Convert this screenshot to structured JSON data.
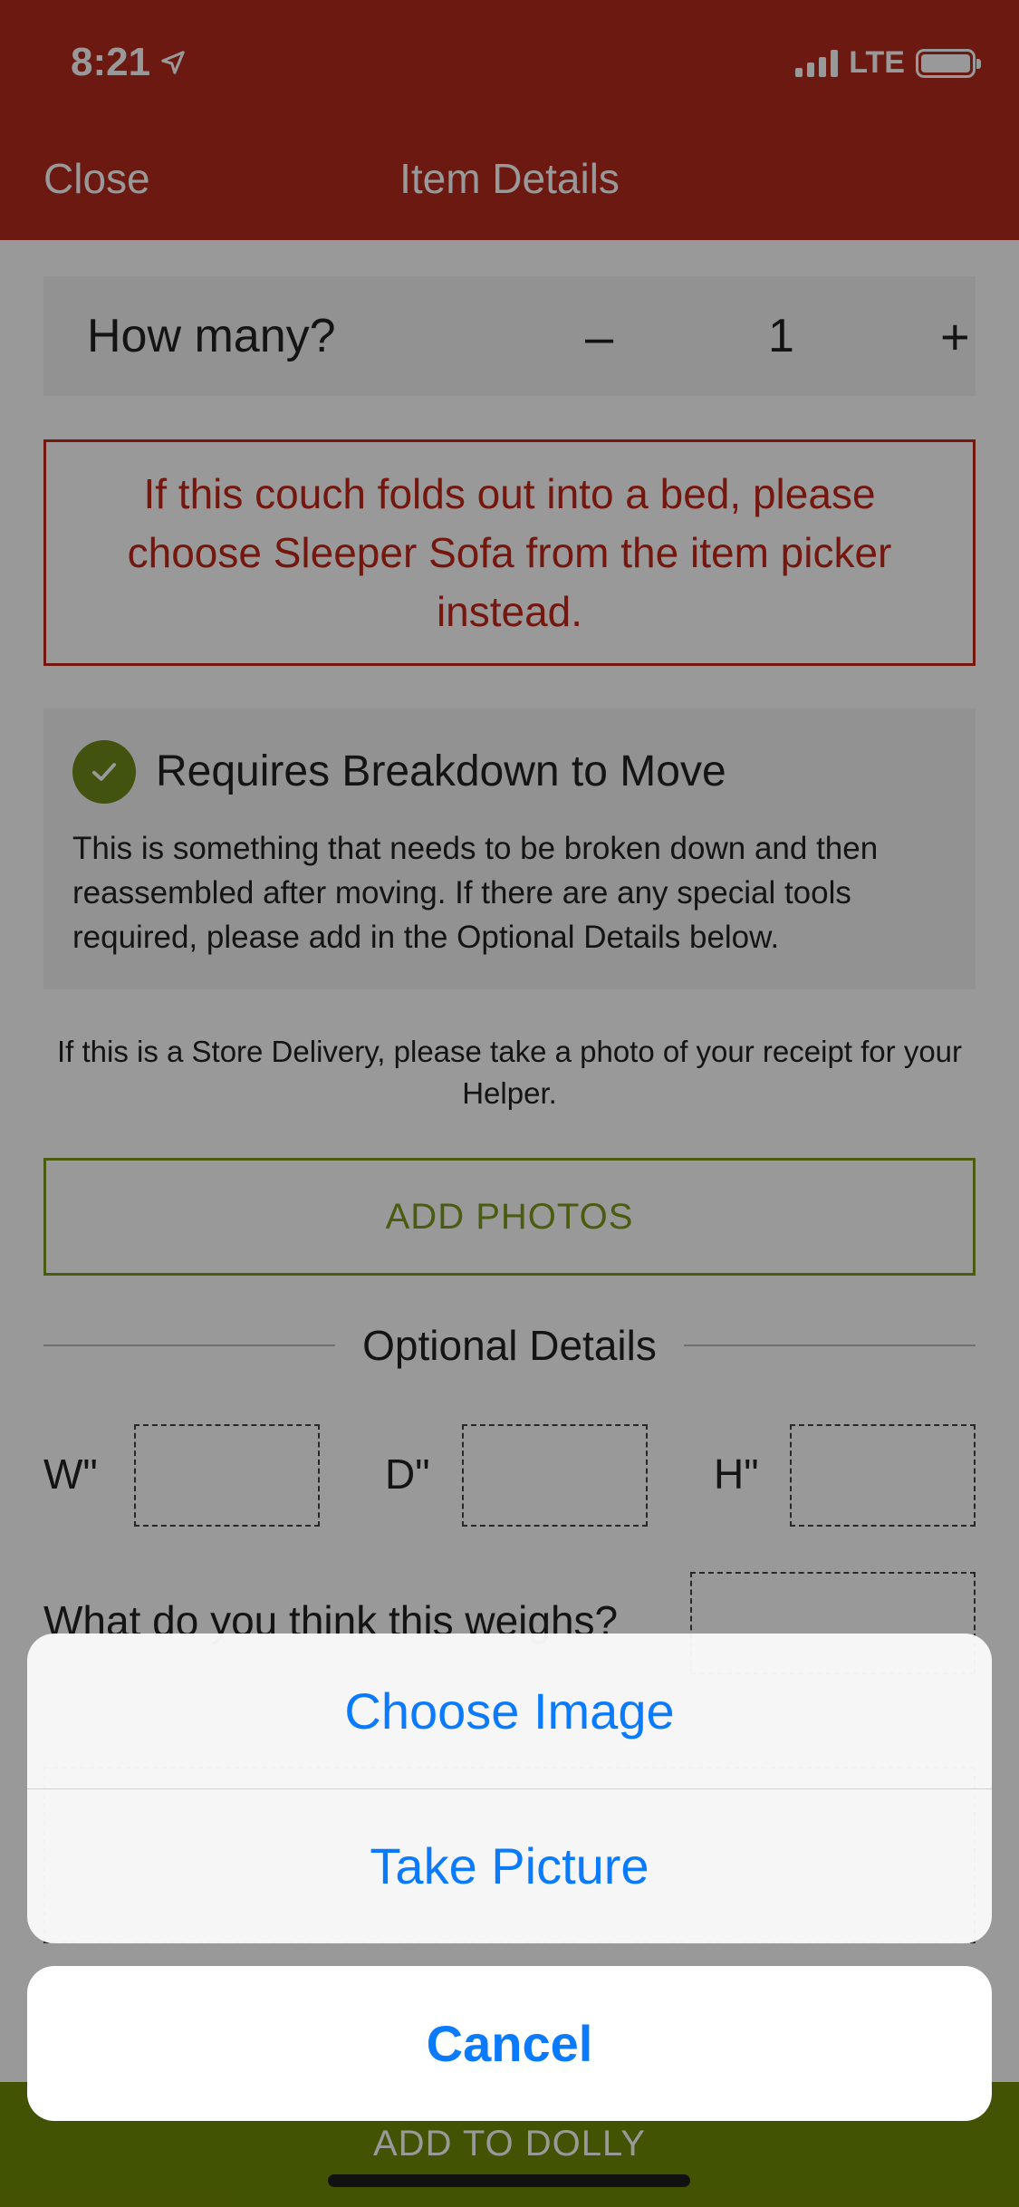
{
  "status_bar": {
    "time": "8:21",
    "network": "LTE",
    "location_icon": "location-arrow-icon",
    "signal_icon": "signal-bars-icon",
    "battery_icon": "battery-icon"
  },
  "header": {
    "close_label": "Close",
    "title": "Item Details",
    "background_color": "#b42b1d"
  },
  "quantity": {
    "label": "How many?",
    "minus_label": "–",
    "value": "1",
    "plus_label": "+"
  },
  "warning": {
    "text": "If this couch folds out into a bed, please choose Sleeper Sofa from the item picker instead.",
    "color": "#c2281a"
  },
  "breakdown": {
    "checked": true,
    "title": "Requires Breakdown to Move",
    "description": "This is something that needs to be broken down and then reassembled after moving. If there are any special tools required, please add in the Optional Details below.",
    "check_icon": "checkmark-icon"
  },
  "receipt_note": "If this is a Store Delivery, please take a photo of your receipt for your Helper.",
  "add_photos_label": "ADD PHOTOS",
  "optional_details": {
    "title": "Optional Details",
    "width_label": "W\"",
    "depth_label": "D\"",
    "height_label": "H\"",
    "weight_question": "What do you think this weighs?"
  },
  "bottom_button_label": "ADD TO DOLLY",
  "action_sheet": {
    "choose_image": "Choose Image",
    "take_picture": "Take Picture",
    "cancel": "Cancel",
    "accent_color": "#0a7aff"
  }
}
